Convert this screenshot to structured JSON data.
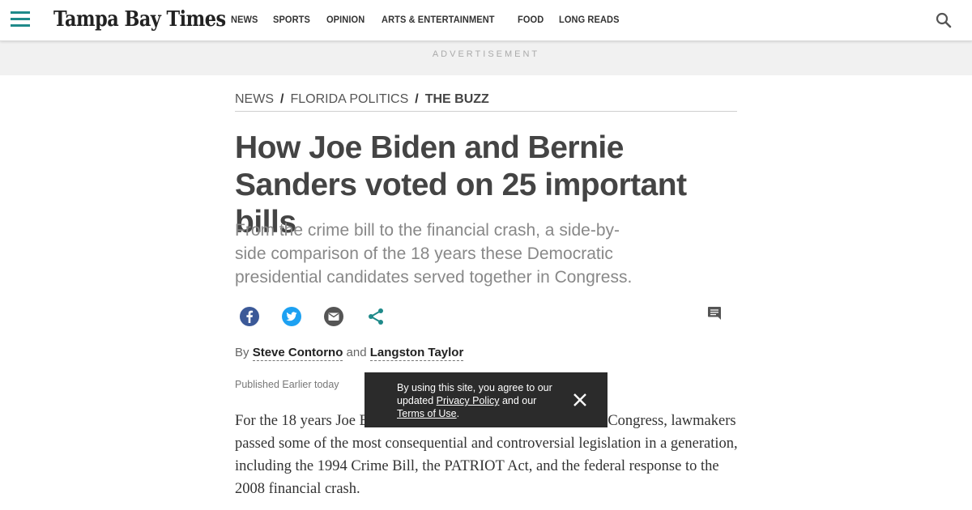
{
  "header": {
    "logo_text": "Tampa Bay Times",
    "nav": [
      {
        "label": "NEWS"
      },
      {
        "label": "SPORTS"
      },
      {
        "label": "OPINION"
      },
      {
        "label": "ARTS & ENTERTAINMENT"
      },
      {
        "label": "FOOD"
      },
      {
        "label": "LONG READS"
      }
    ],
    "menu_icon": "hamburger-menu-icon",
    "search_icon": "search-icon",
    "accent_color": "#1f8a8a"
  },
  "advertisement": {
    "label": "ADVERTISEMENT"
  },
  "breadcrumb": {
    "items": [
      "NEWS",
      "FLORIDA POLITICS"
    ],
    "current": "THE BUZZ",
    "separator": "/"
  },
  "article": {
    "headline": "How Joe Biden and Bernie Sanders voted on 25 important bills",
    "dek": "From the crime bill to the financial crash, a side-by-side comparison of the 18 years these Democratic presidential candidates served together in Congress.",
    "share": {
      "icons": [
        "facebook-icon",
        "twitter-icon",
        "email-icon",
        "share-icon"
      ],
      "comments_icon": "comments-icon"
    },
    "byline": {
      "prefix": "By",
      "author_1": "Steve Contorno",
      "conjunction": "and",
      "author_2": "Langston Taylor"
    },
    "published": "Published Earlier today",
    "body": "For the 18 years Joe Biden and Bernie Sanders both served in Congress, lawmakers passed some of the most consequential and controversial legislation in a generation, including the 1994 Crime Bill, the PATRIOT Act, and the federal response to the 2008 financial crash."
  },
  "cookie_notice": {
    "text_before": "By using this site, you agree to our updated",
    "privacy_link": "Privacy Policy",
    "text_middle": "and our",
    "terms_link": "Terms of Use",
    "text_after": ".",
    "close_icon": "close-icon"
  }
}
